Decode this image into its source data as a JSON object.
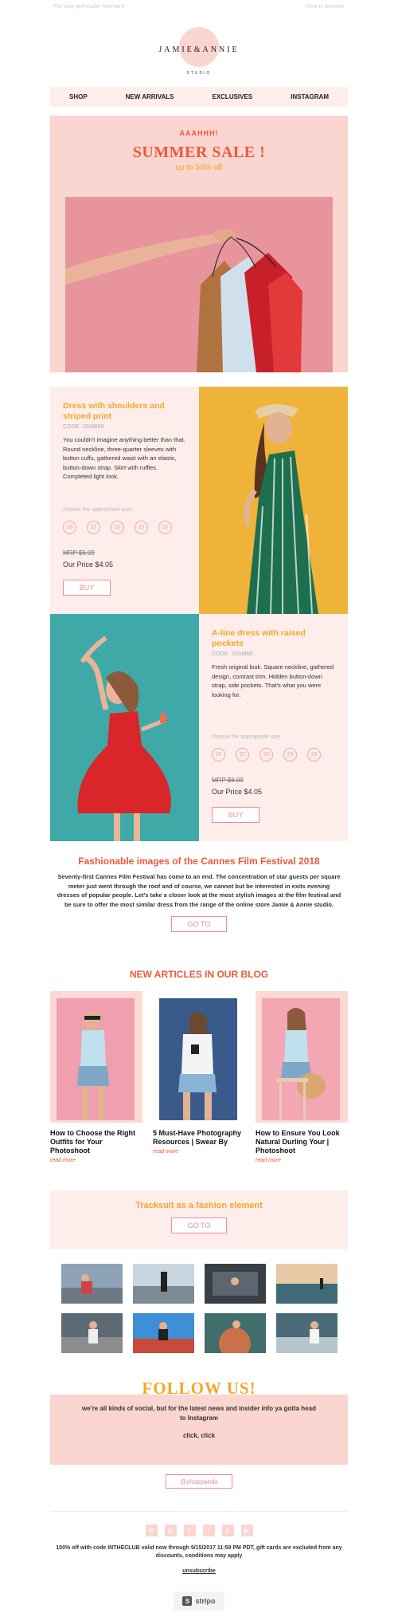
{
  "preheader": {
    "left": "Put your preheader text here",
    "right": "View in browser"
  },
  "brand": {
    "name": "JAMIE&ANNIE",
    "sub": "STUDIO"
  },
  "nav": [
    "SHOP",
    "NEW ARRIVALS",
    "EXCLUSIVES",
    "INSTAGRAM"
  ],
  "hero": {
    "kicker": "AAAHHH!",
    "title": "SUMMER SALE !",
    "subtitle": "up to 50% off"
  },
  "products": [
    {
      "name": "Dress with shoulders and striped print",
      "code": "CODE: 1524868",
      "description": "You couldn't imagine anything better than that. Round neckline, three-quarter sleeves with button cuffs, gathered waist with an elastic, button-down strap. Skirt with ruffles. Completed light look.",
      "size_label": "choose the appropriate size:",
      "sizes": [
        "36",
        "32",
        "30",
        "29",
        "26"
      ],
      "mrp": "MRP $6.09",
      "price": "Our Price $4.05",
      "buy": "BUY"
    },
    {
      "name": "A-line dress with raised pockets",
      "code": "CODE: 1524868",
      "description": "Fresh original look. Square neckline, gathered design, contrast trim. Hidden button-down strap, side pockets. That's what you were looking for.",
      "size_label": "choose the appropriate size:",
      "sizes": [
        "36",
        "32",
        "30",
        "29",
        "26"
      ],
      "mrp": "MRP $6.09",
      "price": "Our Price $4.05",
      "buy": "BUY"
    }
  ],
  "cannes": {
    "title": "Fashionable images of the Cannes Film Festival 2018",
    "text": "Seventy-first Cannes Film Festival has come to an end. The concentration of star guests per square meter just went through the roof and of course, we cannot but be interested in exits evening dresses of popular people. Let's take a closer look at the most stylish images at the film festival and be sure to offer the most similar dress from the range of the online store Jamie & Annie studio.",
    "button": "GO TO"
  },
  "blog": {
    "title": "NEW ARTICLES IN OUR BLOG",
    "articles": [
      {
        "title": "How to Choose the Right Outfits for Your Photoshoot",
        "more": "read more"
      },
      {
        "title": "5 Must-Have Photography Resources | Swear By",
        "more": "read more"
      },
      {
        "title": "How to Ensure You Look Natural Durling Your | Photoshoot",
        "more": "read more"
      }
    ]
  },
  "tracksuit": {
    "title": "Tracksuit as a fashion element",
    "button": "GO TO"
  },
  "follow": {
    "title": "FOLLOW US!",
    "text": "we're all kinds of social, but for the latest news and insider info ya gotta head to Instagram",
    "click": "click, click",
    "handle": "@shoppanda"
  },
  "footer": {
    "socials": [
      "mail-icon",
      "instagram-icon",
      "facebook-icon",
      "twitter-icon",
      "pinterest-icon",
      "youtube-icon"
    ],
    "legal": "100% off with code INTHECLUB valid now through 9/15/2017 11:59 PM PDT, gift cards are excluded from any discounts, conditions may apply",
    "unsubscribe": "unsubscribe",
    "badge": "stripo"
  },
  "colors": {
    "accent_red": "#f0583b",
    "accent_yellow": "#f5a623",
    "pink_bg": "#fbd5cf",
    "light_pink": "#fdeeec",
    "button_pink": "#f28b95"
  }
}
